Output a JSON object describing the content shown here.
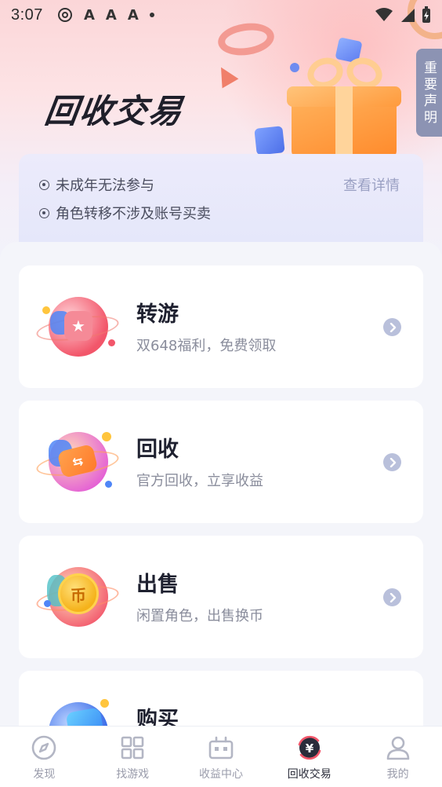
{
  "status_bar": {
    "time": "3:07",
    "left_icons": [
      "disc-icon",
      "font-a-icon",
      "font-a-icon",
      "font-a-icon",
      "dot-icon"
    ],
    "right_icons": [
      "wifi-icon",
      "signal-icon",
      "battery-charging-icon"
    ]
  },
  "hero": {
    "title": "回收交易",
    "notice_tab": "重要声明"
  },
  "notice": {
    "lines": [
      "未成年无法参与",
      "角色转移不涉及账号买卖"
    ],
    "detail_link": "查看详情"
  },
  "features": [
    {
      "title": "转游",
      "subtitle": "双648福利，免费领取",
      "icon": "star-bag-icon",
      "accent": "#f2566a"
    },
    {
      "title": "回收",
      "subtitle": "官方回收，立享收益",
      "icon": "exchange-ticket-icon",
      "accent": "#ff8a3c"
    },
    {
      "title": "出售",
      "subtitle": "闲置角色，出售换币",
      "icon": "coin-icon",
      "accent": "#f5b21b",
      "icon_text": "币"
    },
    {
      "title": "购买",
      "subtitle": "",
      "icon": "wallet-icon",
      "accent": "#4d7df0"
    }
  ],
  "bottom_nav": [
    {
      "label": "发现",
      "icon": "compass-icon",
      "active": false
    },
    {
      "label": "找游戏",
      "icon": "grid-icon",
      "active": false
    },
    {
      "label": "收益中心",
      "icon": "robot-icon",
      "active": false
    },
    {
      "label": "回收交易",
      "icon": "yuan-exchange-icon",
      "active": true
    },
    {
      "label": "我的",
      "icon": "user-icon",
      "active": false
    }
  ],
  "colors": {
    "accent_dark": "#1f2130",
    "muted": "#8a8d9c",
    "notice_tab": "#8c93b3"
  }
}
